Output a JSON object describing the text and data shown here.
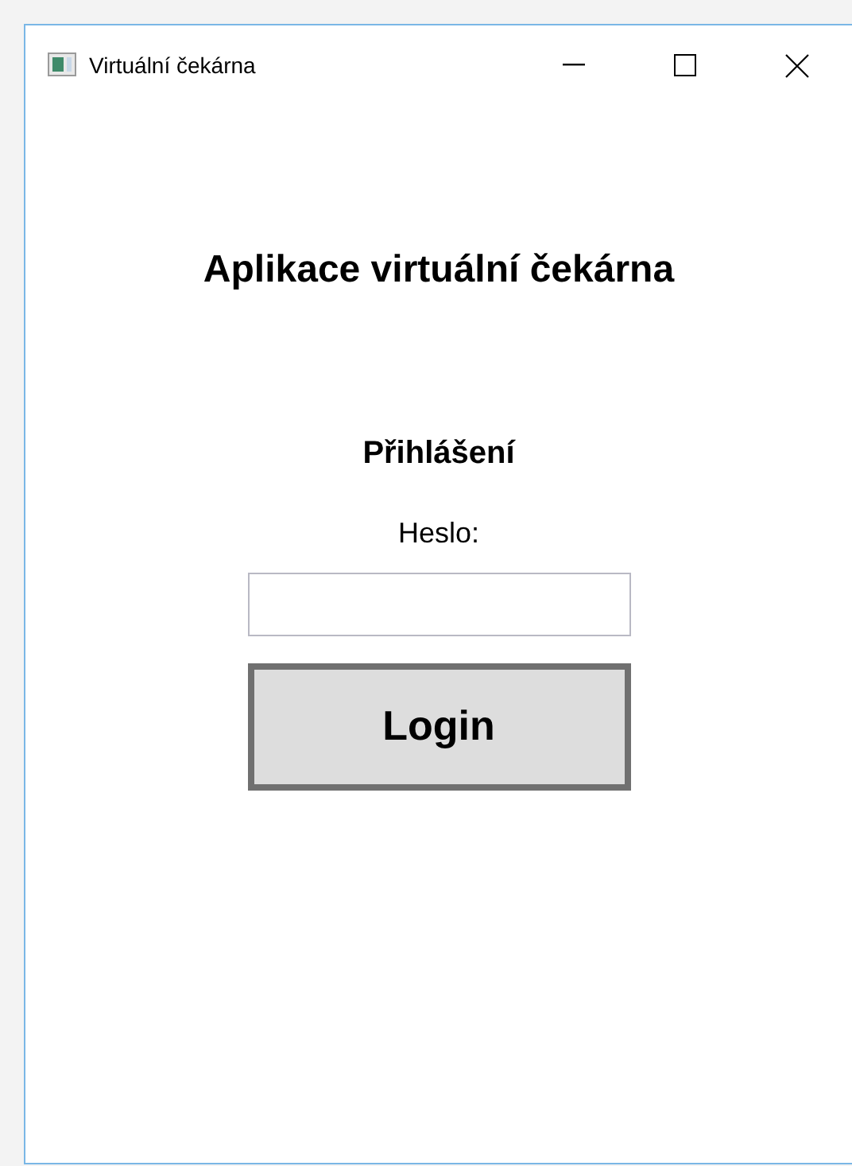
{
  "window": {
    "title": "Virtuální čekárna"
  },
  "heading": "Aplikace virtuální čekárna",
  "login": {
    "title": "Přihlášení",
    "password_label": "Heslo:",
    "button": "Login"
  }
}
